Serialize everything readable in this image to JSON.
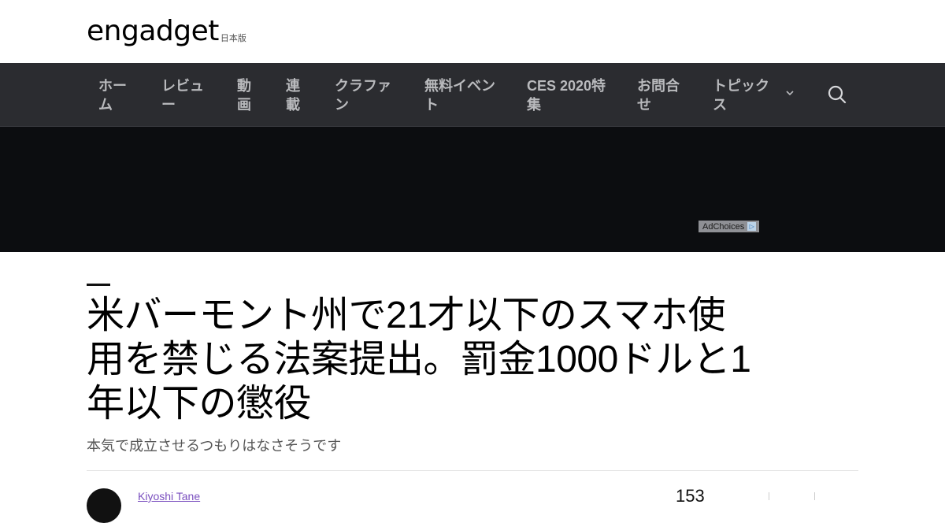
{
  "header": {
    "logo_text": "engadget",
    "logo_sub": "日本版"
  },
  "nav": {
    "items": [
      {
        "label": "ホーム"
      },
      {
        "label": "レビュー"
      },
      {
        "label": "動画"
      },
      {
        "label": "連載"
      },
      {
        "label": "クラファン"
      },
      {
        "label": "無料イベント"
      },
      {
        "label": "CES 2020特集"
      },
      {
        "label": "お問合せ"
      },
      {
        "label": "トピックス"
      }
    ],
    "search_icon": "search-icon",
    "chevron_icon": "chevron-down-icon"
  },
  "ad": {
    "adchoices_label": "AdChoices",
    "adchoices_icon": "▷"
  },
  "article": {
    "title": "米バーモント州で21才以下のスマホ使用を禁じる法案提出。罰金1000ドルと1年以下の懲役",
    "subtitle": "本気で成立させるつもりはなさそうです",
    "author": "Kiyoshi Tane",
    "share_count": "153"
  },
  "colors": {
    "nav_bg": "#2b2c30",
    "nav_text": "#b9babd",
    "ad_bg": "#0c0d10",
    "author_link": "#7a4fbf"
  }
}
